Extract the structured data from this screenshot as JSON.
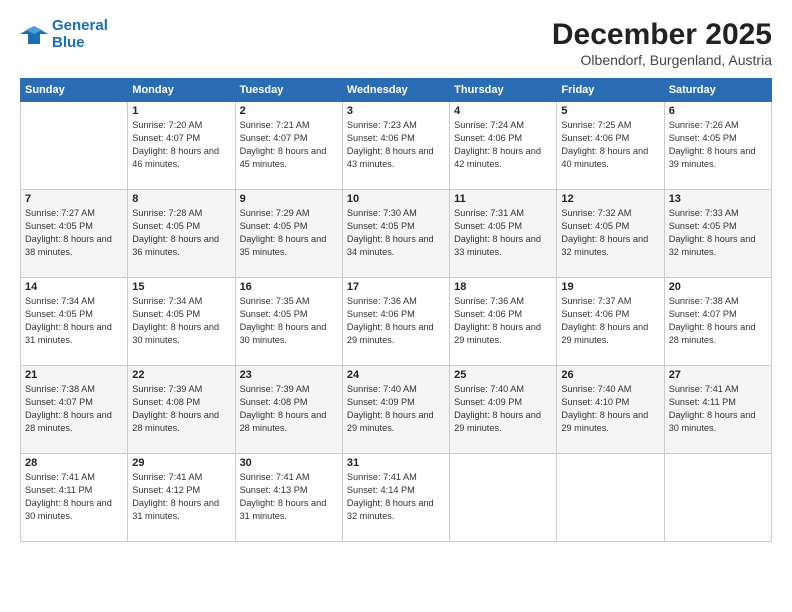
{
  "logo": {
    "line1": "General",
    "line2": "Blue"
  },
  "title": "December 2025",
  "subtitle": "Olbendorf, Burgenland, Austria",
  "days_of_week": [
    "Sunday",
    "Monday",
    "Tuesday",
    "Wednesday",
    "Thursday",
    "Friday",
    "Saturday"
  ],
  "weeks": [
    [
      {
        "day": "",
        "sunrise": "",
        "sunset": "",
        "daylight": ""
      },
      {
        "day": "1",
        "sunrise": "Sunrise: 7:20 AM",
        "sunset": "Sunset: 4:07 PM",
        "daylight": "Daylight: 8 hours and 46 minutes."
      },
      {
        "day": "2",
        "sunrise": "Sunrise: 7:21 AM",
        "sunset": "Sunset: 4:07 PM",
        "daylight": "Daylight: 8 hours and 45 minutes."
      },
      {
        "day": "3",
        "sunrise": "Sunrise: 7:23 AM",
        "sunset": "Sunset: 4:06 PM",
        "daylight": "Daylight: 8 hours and 43 minutes."
      },
      {
        "day": "4",
        "sunrise": "Sunrise: 7:24 AM",
        "sunset": "Sunset: 4:06 PM",
        "daylight": "Daylight: 8 hours and 42 minutes."
      },
      {
        "day": "5",
        "sunrise": "Sunrise: 7:25 AM",
        "sunset": "Sunset: 4:06 PM",
        "daylight": "Daylight: 8 hours and 40 minutes."
      },
      {
        "day": "6",
        "sunrise": "Sunrise: 7:26 AM",
        "sunset": "Sunset: 4:05 PM",
        "daylight": "Daylight: 8 hours and 39 minutes."
      }
    ],
    [
      {
        "day": "7",
        "sunrise": "Sunrise: 7:27 AM",
        "sunset": "Sunset: 4:05 PM",
        "daylight": "Daylight: 8 hours and 38 minutes."
      },
      {
        "day": "8",
        "sunrise": "Sunrise: 7:28 AM",
        "sunset": "Sunset: 4:05 PM",
        "daylight": "Daylight: 8 hours and 36 minutes."
      },
      {
        "day": "9",
        "sunrise": "Sunrise: 7:29 AM",
        "sunset": "Sunset: 4:05 PM",
        "daylight": "Daylight: 8 hours and 35 minutes."
      },
      {
        "day": "10",
        "sunrise": "Sunrise: 7:30 AM",
        "sunset": "Sunset: 4:05 PM",
        "daylight": "Daylight: 8 hours and 34 minutes."
      },
      {
        "day": "11",
        "sunrise": "Sunrise: 7:31 AM",
        "sunset": "Sunset: 4:05 PM",
        "daylight": "Daylight: 8 hours and 33 minutes."
      },
      {
        "day": "12",
        "sunrise": "Sunrise: 7:32 AM",
        "sunset": "Sunset: 4:05 PM",
        "daylight": "Daylight: 8 hours and 32 minutes."
      },
      {
        "day": "13",
        "sunrise": "Sunrise: 7:33 AM",
        "sunset": "Sunset: 4:05 PM",
        "daylight": "Daylight: 8 hours and 32 minutes."
      }
    ],
    [
      {
        "day": "14",
        "sunrise": "Sunrise: 7:34 AM",
        "sunset": "Sunset: 4:05 PM",
        "daylight": "Daylight: 8 hours and 31 minutes."
      },
      {
        "day": "15",
        "sunrise": "Sunrise: 7:34 AM",
        "sunset": "Sunset: 4:05 PM",
        "daylight": "Daylight: 8 hours and 30 minutes."
      },
      {
        "day": "16",
        "sunrise": "Sunrise: 7:35 AM",
        "sunset": "Sunset: 4:05 PM",
        "daylight": "Daylight: 8 hours and 30 minutes."
      },
      {
        "day": "17",
        "sunrise": "Sunrise: 7:36 AM",
        "sunset": "Sunset: 4:06 PM",
        "daylight": "Daylight: 8 hours and 29 minutes."
      },
      {
        "day": "18",
        "sunrise": "Sunrise: 7:36 AM",
        "sunset": "Sunset: 4:06 PM",
        "daylight": "Daylight: 8 hours and 29 minutes."
      },
      {
        "day": "19",
        "sunrise": "Sunrise: 7:37 AM",
        "sunset": "Sunset: 4:06 PM",
        "daylight": "Daylight: 8 hours and 29 minutes."
      },
      {
        "day": "20",
        "sunrise": "Sunrise: 7:38 AM",
        "sunset": "Sunset: 4:07 PM",
        "daylight": "Daylight: 8 hours and 28 minutes."
      }
    ],
    [
      {
        "day": "21",
        "sunrise": "Sunrise: 7:38 AM",
        "sunset": "Sunset: 4:07 PM",
        "daylight": "Daylight: 8 hours and 28 minutes."
      },
      {
        "day": "22",
        "sunrise": "Sunrise: 7:39 AM",
        "sunset": "Sunset: 4:08 PM",
        "daylight": "Daylight: 8 hours and 28 minutes."
      },
      {
        "day": "23",
        "sunrise": "Sunrise: 7:39 AM",
        "sunset": "Sunset: 4:08 PM",
        "daylight": "Daylight: 8 hours and 28 minutes."
      },
      {
        "day": "24",
        "sunrise": "Sunrise: 7:40 AM",
        "sunset": "Sunset: 4:09 PM",
        "daylight": "Daylight: 8 hours and 29 minutes."
      },
      {
        "day": "25",
        "sunrise": "Sunrise: 7:40 AM",
        "sunset": "Sunset: 4:09 PM",
        "daylight": "Daylight: 8 hours and 29 minutes."
      },
      {
        "day": "26",
        "sunrise": "Sunrise: 7:40 AM",
        "sunset": "Sunset: 4:10 PM",
        "daylight": "Daylight: 8 hours and 29 minutes."
      },
      {
        "day": "27",
        "sunrise": "Sunrise: 7:41 AM",
        "sunset": "Sunset: 4:11 PM",
        "daylight": "Daylight: 8 hours and 30 minutes."
      }
    ],
    [
      {
        "day": "28",
        "sunrise": "Sunrise: 7:41 AM",
        "sunset": "Sunset: 4:11 PM",
        "daylight": "Daylight: 8 hours and 30 minutes."
      },
      {
        "day": "29",
        "sunrise": "Sunrise: 7:41 AM",
        "sunset": "Sunset: 4:12 PM",
        "daylight": "Daylight: 8 hours and 31 minutes."
      },
      {
        "day": "30",
        "sunrise": "Sunrise: 7:41 AM",
        "sunset": "Sunset: 4:13 PM",
        "daylight": "Daylight: 8 hours and 31 minutes."
      },
      {
        "day": "31",
        "sunrise": "Sunrise: 7:41 AM",
        "sunset": "Sunset: 4:14 PM",
        "daylight": "Daylight: 8 hours and 32 minutes."
      },
      {
        "day": "",
        "sunrise": "",
        "sunset": "",
        "daylight": ""
      },
      {
        "day": "",
        "sunrise": "",
        "sunset": "",
        "daylight": ""
      },
      {
        "day": "",
        "sunrise": "",
        "sunset": "",
        "daylight": ""
      }
    ]
  ]
}
